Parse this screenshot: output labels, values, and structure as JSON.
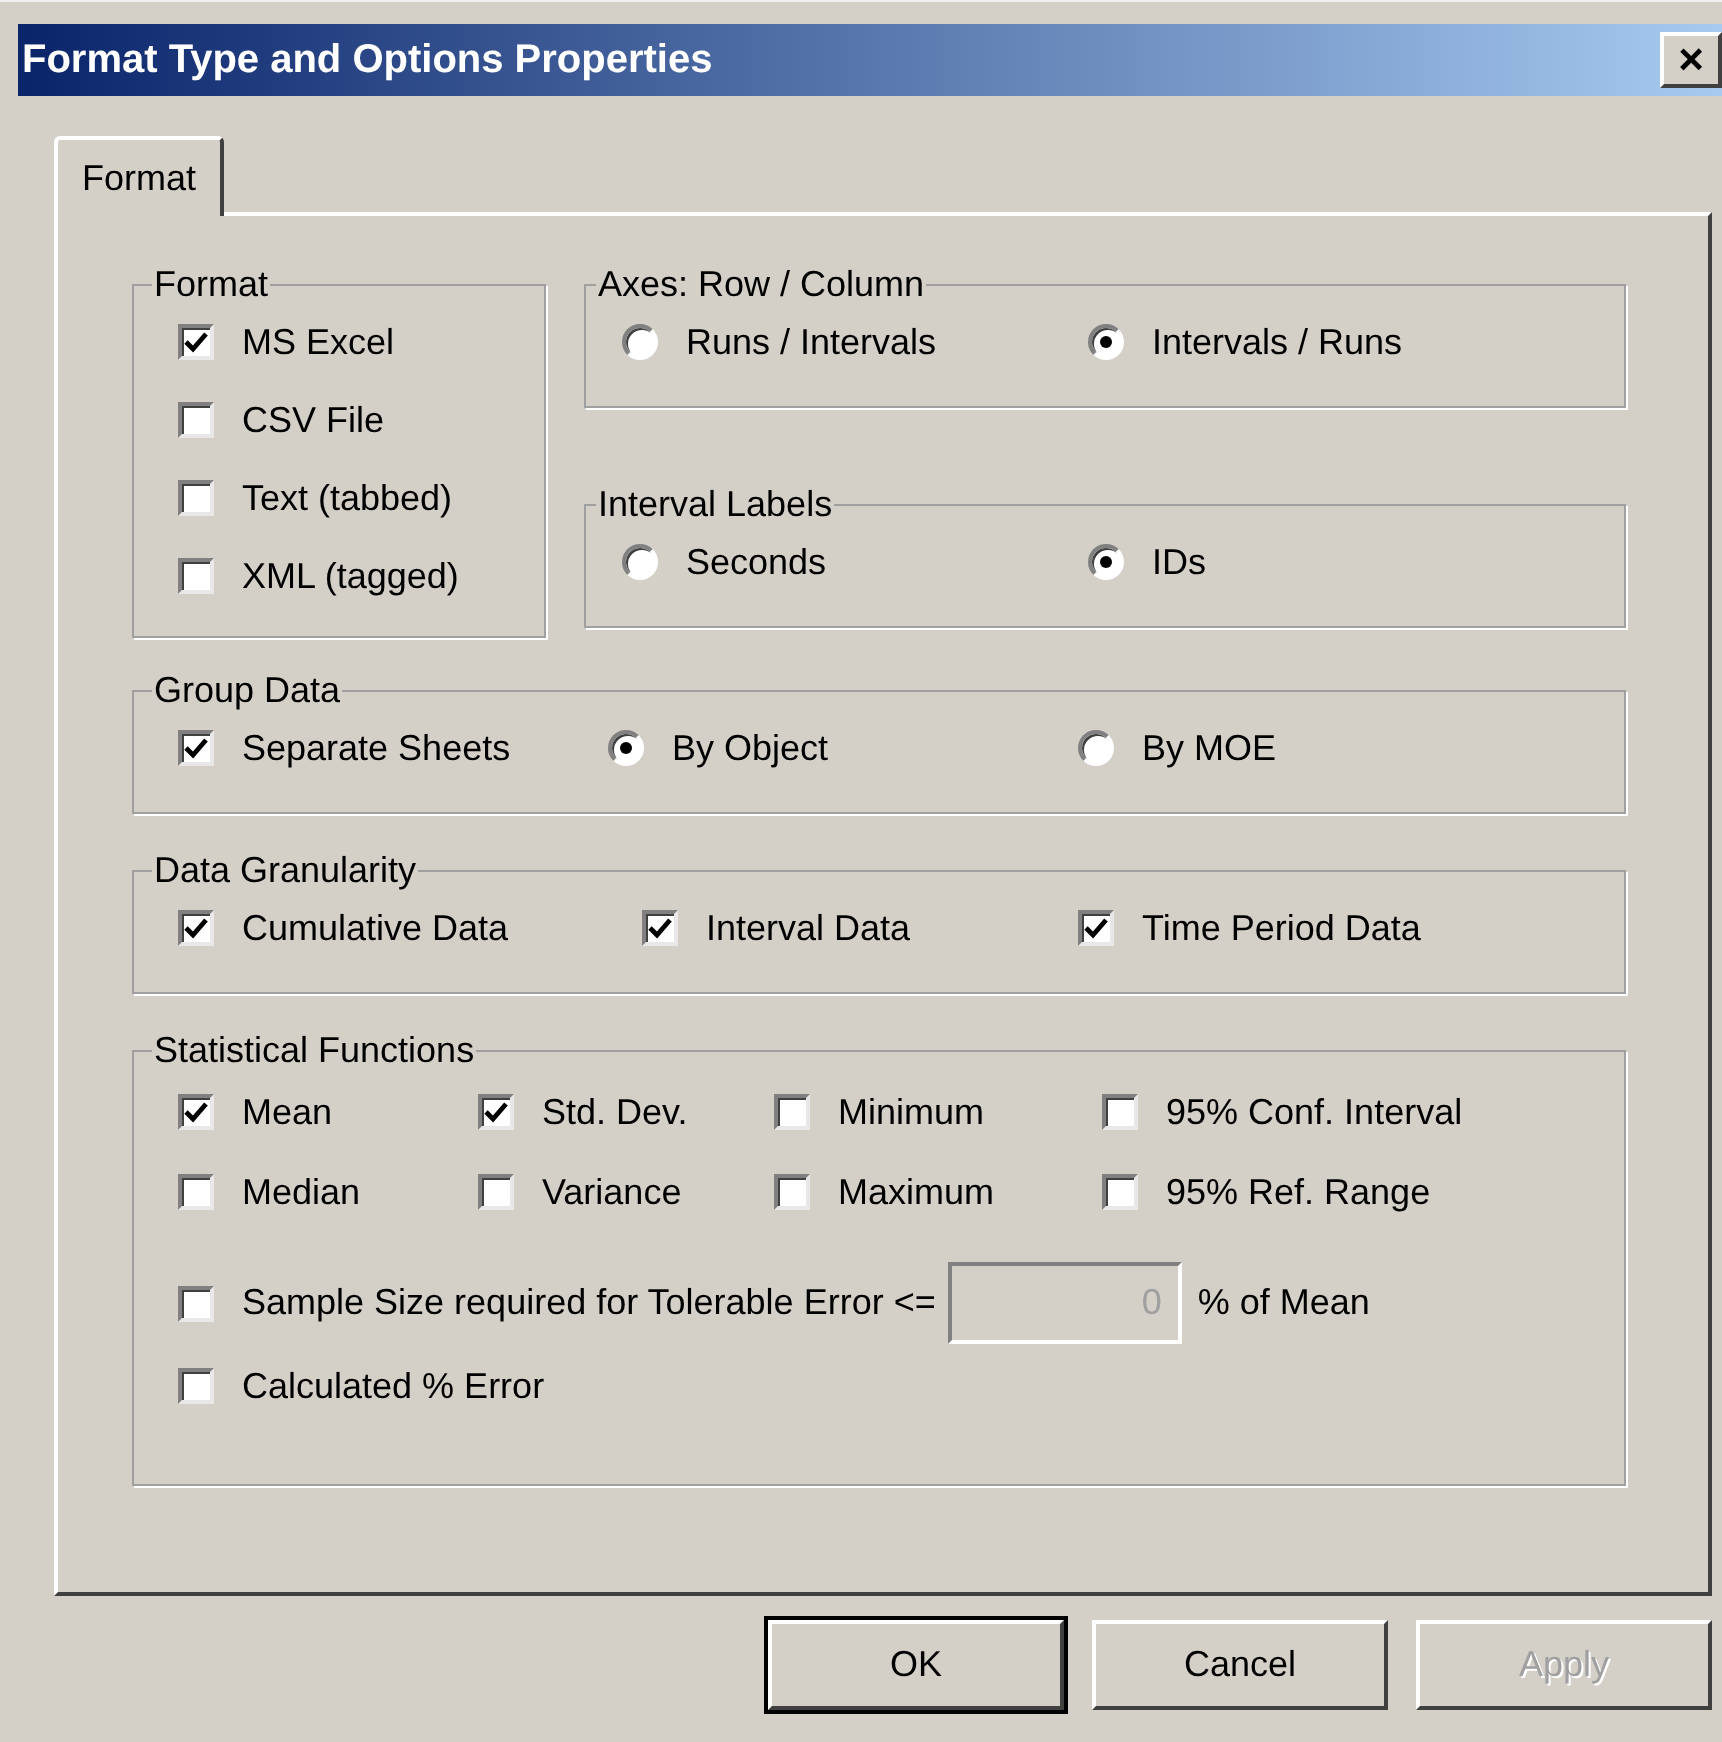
{
  "window": {
    "title": "Format Type and Options Properties",
    "close": "×"
  },
  "tabs": [
    {
      "label": "Format",
      "selected": true
    }
  ],
  "format_group": {
    "title": "Format",
    "options": [
      {
        "label": "MS Excel",
        "checked": true
      },
      {
        "label": "CSV File",
        "checked": false
      },
      {
        "label": "Text (tabbed)",
        "checked": false
      },
      {
        "label": "XML (tagged)",
        "checked": false
      }
    ]
  },
  "axes_group": {
    "title": "Axes: Row / Column",
    "options": [
      {
        "label": "Runs / Intervals",
        "selected": false
      },
      {
        "label": "Intervals / Runs",
        "selected": true
      }
    ]
  },
  "interval_labels": {
    "title": "Interval Labels",
    "options": [
      {
        "label": "Seconds",
        "selected": false
      },
      {
        "label": "IDs",
        "selected": true
      }
    ]
  },
  "group_data": {
    "title": "Group Data",
    "items": [
      {
        "kind": "checkbox",
        "label": "Separate Sheets",
        "checked": true
      },
      {
        "kind": "radio",
        "label": "By Object",
        "selected": true
      },
      {
        "kind": "radio",
        "label": "By MOE",
        "selected": false
      }
    ]
  },
  "data_granularity": {
    "title": "Data Granularity",
    "options": [
      {
        "label": "Cumulative Data",
        "checked": true
      },
      {
        "label": "Interval Data",
        "checked": true
      },
      {
        "label": "Time Period Data",
        "checked": true
      }
    ]
  },
  "statistical_functions": {
    "title": "Statistical Functions",
    "options": [
      {
        "label": "Mean",
        "checked": true
      },
      {
        "label": "Std. Dev.",
        "checked": true
      },
      {
        "label": "Minimum",
        "checked": false
      },
      {
        "label": "95% Conf. Interval",
        "checked": false
      },
      {
        "label": "Median",
        "checked": false
      },
      {
        "label": "Variance",
        "checked": false
      },
      {
        "label": "Maximum",
        "checked": false
      },
      {
        "label": "95% Ref. Range",
        "checked": false
      }
    ],
    "sample_size": {
      "label": "Sample Size required for Tolerable Error <=",
      "checked": false,
      "value": "0",
      "disabled": true,
      "suffix": "% of Mean"
    },
    "calculated_error": {
      "label": "Calculated % Error",
      "checked": false
    }
  },
  "buttons": [
    {
      "label": "OK",
      "default": true,
      "disabled": false
    },
    {
      "label": "Cancel",
      "default": false,
      "disabled": false
    },
    {
      "label": "Apply",
      "default": false,
      "disabled": true
    }
  ]
}
